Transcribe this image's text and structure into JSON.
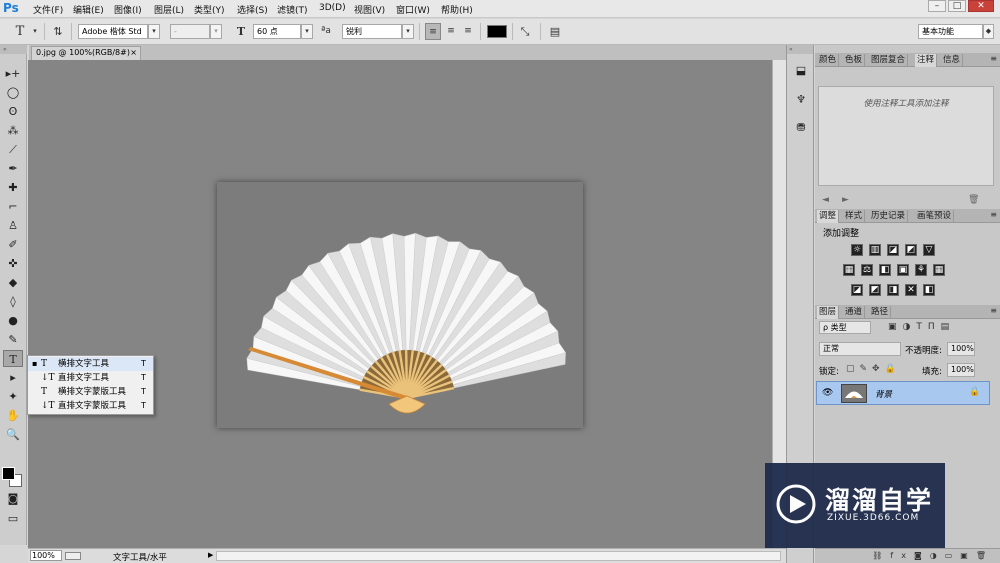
{
  "app": {
    "logo": "Ps"
  },
  "menubar": {
    "items": [
      "文件(F)",
      "编辑(E)",
      "图像(I)",
      "图层(L)",
      "类型(Y)",
      "选择(S)",
      "滤镜(T)",
      "3D(D)",
      "视图(V)",
      "窗口(W)",
      "帮助(H)"
    ],
    "minimize": "–",
    "restore": "□",
    "close": "✕"
  },
  "options": {
    "tool_glyph": "T",
    "orient_glyph": "⇅",
    "font_family": "Adobe 楷体 Std",
    "font_style": "-",
    "size_glyph": "T",
    "font_size": "60 点",
    "aa_label": "ªa",
    "antialias": "锐利",
    "workspace": "基本功能",
    "color": "#000000"
  },
  "tab": {
    "title": "0.jpg @ 100%(RGB/8#)",
    "close": "×"
  },
  "toolbar": {
    "tools": [
      "▸+",
      "◯",
      "ʘ",
      "⁂",
      "⟋",
      "✒",
      "✚",
      "⌐",
      "♙",
      "✐",
      "✜",
      "◆",
      "◊",
      "●",
      "✎",
      "T",
      "▸",
      "✦",
      "✋",
      "🔍"
    ]
  },
  "flyout": {
    "items": [
      {
        "glyph": "T",
        "label": "横排文字工具",
        "key": "T",
        "selected": true
      },
      {
        "glyph": "↓T",
        "label": "直排文字工具",
        "key": "T",
        "selected": false
      },
      {
        "glyph": "T",
        "label": "横排文字蒙版工具",
        "key": "T",
        "selected": false
      },
      {
        "glyph": "↓T",
        "label": "直排文字蒙版工具",
        "key": "T",
        "selected": false
      }
    ]
  },
  "status": {
    "zoom": "100%",
    "tool_info": "文字工具/水平",
    "arrow": "▶"
  },
  "panel_top": {
    "tabs": [
      "颜色",
      "色板",
      "图层复合",
      "注释",
      "信息"
    ],
    "active": "注释",
    "hint": "使用注释工具添加注释"
  },
  "panel_adjust": {
    "tabs": [
      "调整",
      "样式",
      "历史记录",
      "画笔预设"
    ],
    "active": "调整",
    "title": "添加调整"
  },
  "panel_layers": {
    "tabs": [
      "图层",
      "通道",
      "路径"
    ],
    "active": "图层",
    "filter": "ρ 类型",
    "blend": "正常",
    "opacity_label": "不透明度:",
    "opacity": "100%",
    "lock_label": "锁定:",
    "fill_label": "填充:",
    "fill": "100%",
    "layer_name": "背景"
  },
  "watermark": {
    "name": "溜溜自学",
    "url": "ZIXUE.3D66.COM"
  }
}
